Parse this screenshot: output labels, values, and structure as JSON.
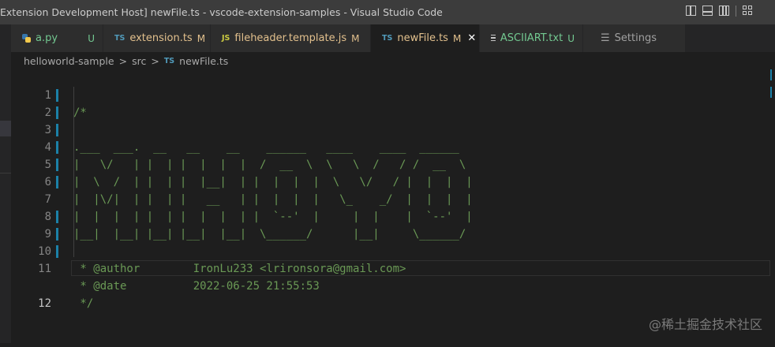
{
  "window": {
    "title": "Extension Development Host] newFile.ts - vscode-extension-samples - Visual Studio Code"
  },
  "tabs": [
    {
      "label": "a.py",
      "icon": "python-file-icon",
      "badge": "U",
      "status": "u"
    },
    {
      "label": "extension.ts",
      "icon": "typescript-file-icon",
      "icon_text": "TS",
      "badge": "M",
      "status": "m"
    },
    {
      "label": "fileheader.template.js",
      "icon": "javascript-file-icon",
      "icon_text": "JS",
      "badge": "M",
      "status": "m"
    },
    {
      "label": "newFile.ts",
      "icon": "typescript-file-icon",
      "icon_text": "TS",
      "badge": "M",
      "status": "m",
      "active": true
    },
    {
      "label": "ASCIIART.txt",
      "icon": "text-file-icon",
      "badge": "U",
      "status": "u"
    },
    {
      "label": "Settings",
      "icon": "gear-icon",
      "badge": "",
      "status": ""
    }
  ],
  "breadcrumb": {
    "items": [
      "helloworld-sample",
      "src",
      "newFile.ts"
    ],
    "file_icon_text": "TS"
  },
  "editor": {
    "lines": [
      {
        "num": "1",
        "text": "/*"
      },
      {
        "num": "2",
        "text": ".___  ___.  __   __    __    ______   ____    ____  ______"
      },
      {
        "num": "3",
        "text": "|   \\/   | |  | |  |  |  |  /  __  \\  \\   \\  /   / /  __  \\"
      },
      {
        "num": "4",
        "text": "|  \\  /  | |  | |  |__|  | |  |  |  |  \\   \\/   / |  |  |  |"
      },
      {
        "num": "5",
        "text": "|  |\\/|  | |  | |   __   | |  |  |  |   \\_    _/  |  |  |  |"
      },
      {
        "num": "6",
        "text": "|  |  |  | |  | |  |  |  | |  `--'  |     |  |    |  `--'  |"
      },
      {
        "num": "7",
        "text": "|__|  |__| |__| |__|  |__|  \\______/      |__|     \\______/"
      },
      {
        "num": "8",
        "text": ""
      },
      {
        "num": "9",
        "text": " * @author        IronLu233 <lrironsora@gmail.com>"
      },
      {
        "num": "10",
        "text": " * @date          2022-06-25 21:55:53"
      },
      {
        "num": "11",
        "text": " */"
      },
      {
        "num": "12",
        "text": ""
      }
    ],
    "current_line": 12,
    "comment_color": "#6a9955",
    "modified_gutter_color": "#1b81a8"
  },
  "watermark": "@稀土掘金技术社区",
  "colors": {
    "titlebar": "#3c3c3c",
    "tabbar": "#252526",
    "editor_bg": "#1e1e1e",
    "modified": "#e2c08d",
    "untracked": "#73c991",
    "ts_icon": "#519aba",
    "js_icon": "#cbcb41"
  }
}
